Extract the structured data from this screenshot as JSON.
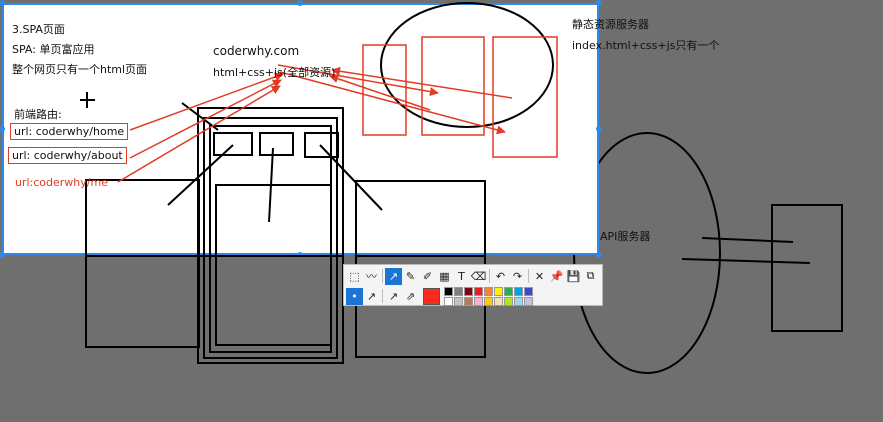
{
  "notes": {
    "spa_title": "3.SPA页面",
    "spa_def": "SPA: 单页富应用",
    "spa_desc": "整个网页只有一个html页面",
    "domain": "coderwhy.com",
    "resources": "html+css+js(全部资源)",
    "frontend_routing": "前端路由:",
    "url_home": "url: coderwhy/home",
    "url_about": "url: coderwhy/about",
    "url_me": "url:coderwhy/me",
    "static_server": "静态资源服务器",
    "static_server_desc": "index.html+css+js只有一个",
    "api_server": "API服务器"
  },
  "toolbar": {
    "row1": [
      {
        "name": "rectangle-select-tool",
        "icon": "⬚"
      },
      {
        "name": "freehand-tool",
        "icon": "〰"
      },
      {
        "name": "arrow-tool",
        "icon": "↗",
        "active": true
      },
      {
        "name": "pen-tool",
        "icon": "✎"
      },
      {
        "name": "marker-tool",
        "icon": "✐"
      },
      {
        "name": "mosaic-tool",
        "icon": "▦"
      },
      {
        "name": "text-tool",
        "icon": "T"
      },
      {
        "name": "eraser-tool",
        "icon": "⌫"
      },
      {
        "name": "undo-tool",
        "icon": "↶"
      },
      {
        "name": "redo-tool",
        "icon": "↷"
      },
      {
        "name": "close-tool",
        "icon": "✕"
      },
      {
        "name": "pin-tool",
        "icon": "📌"
      },
      {
        "name": "save-tool",
        "icon": "💾"
      },
      {
        "name": "copy-tool",
        "icon": "⧉"
      }
    ],
    "row2": [
      {
        "name": "dot-size-tool",
        "icon": "•",
        "active": true
      },
      {
        "name": "arrow-style-1",
        "icon": "↗"
      },
      {
        "name": "arrow-style-2",
        "icon": "↗"
      },
      {
        "name": "arrow-style-3",
        "icon": "⇗"
      }
    ],
    "current_color": "#ff2a1f",
    "palette": [
      "#000000",
      "#7f7f7f",
      "#880015",
      "#ed1c24",
      "#ff7f27",
      "#fff200",
      "#22b14c",
      "#00a2e8",
      "#3f48cc",
      "#ffffff",
      "#c3c3c3",
      "#b97a57",
      "#ffaec9",
      "#ffc90e",
      "#efe4b0",
      "#b5e61d",
      "#99d9ea",
      "#c8bfe7"
    ]
  }
}
